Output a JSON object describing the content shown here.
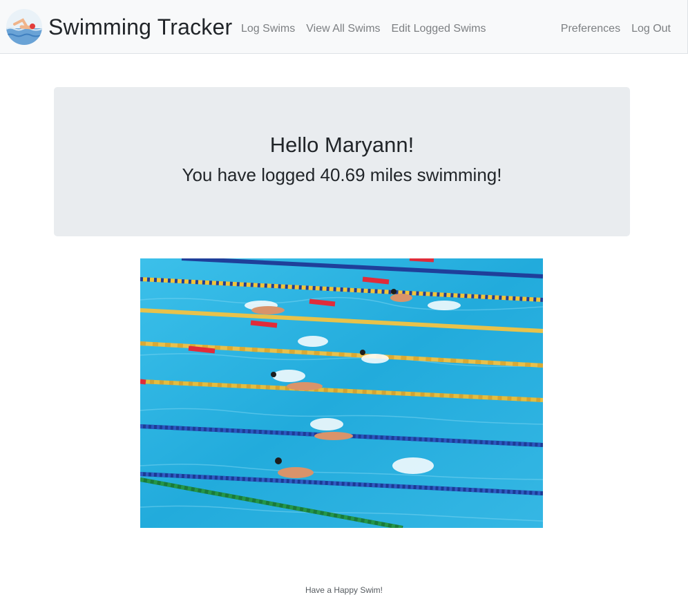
{
  "navbar": {
    "brand": "Swimming Tracker",
    "left_links": [
      "Log Swims",
      "View All Swims",
      "Edit Logged Swims"
    ],
    "right_links": [
      "Preferences",
      "Log Out"
    ],
    "logo_icon": "swimmer-icon"
  },
  "jumbotron": {
    "greeting": "Hello Maryann!",
    "summary": "You have logged 40.69 miles swimming!"
  },
  "hero_image": {
    "subject": "swimmers-pool-photo"
  },
  "footer": {
    "text": "Have a Happy Swim!"
  },
  "colors": {
    "navbar_bg": "#f8f9fa",
    "jumbotron_bg": "#e9ecef",
    "link": "#7c7f82",
    "pool_water": "#2bb3df"
  }
}
